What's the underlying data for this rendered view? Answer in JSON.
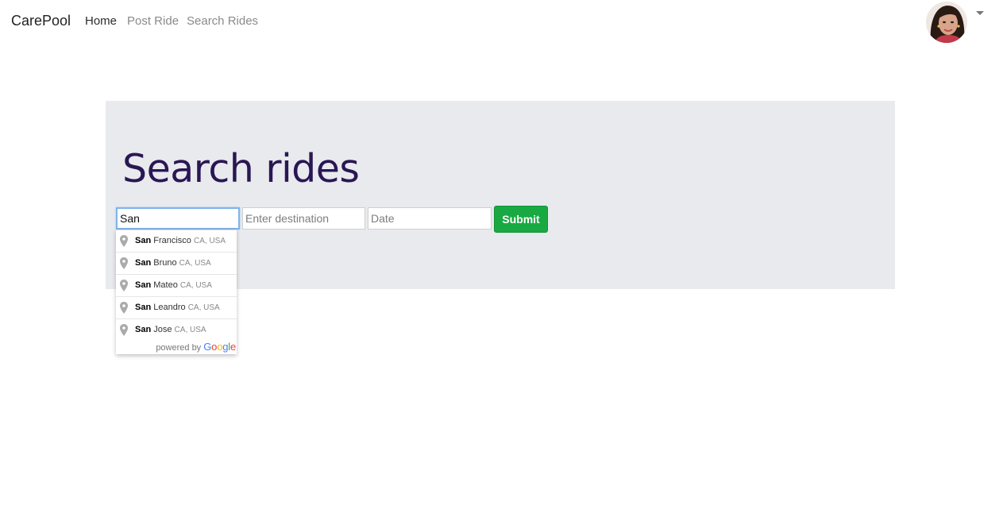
{
  "navbar": {
    "brand": "CarePool",
    "links": [
      {
        "label": "Home",
        "active": true
      },
      {
        "label": "Post Ride",
        "active": false
      },
      {
        "label": "Search Rides",
        "active": false
      }
    ],
    "profile_icon": "avatar-photo",
    "dropdown_icon": "caret-down-icon"
  },
  "jumbotron": {
    "title": "Search rides"
  },
  "form": {
    "origin_value": "San",
    "destination_placeholder": "Enter destination",
    "date_placeholder": "Date",
    "submit_label": "Submit"
  },
  "autocomplete": {
    "suggestions": [
      {
        "match": "San",
        "rest": " Francisco",
        "secondary": "CA, USA"
      },
      {
        "match": "San",
        "rest": " Bruno",
        "secondary": "CA, USA"
      },
      {
        "match": "San",
        "rest": " Mateo",
        "secondary": "CA, USA"
      },
      {
        "match": "San",
        "rest": " Leandro",
        "secondary": "CA, USA"
      },
      {
        "match": "San",
        "rest": " Jose",
        "secondary": "CA, USA"
      }
    ],
    "powered_by": "powered by",
    "google_letters": [
      "G",
      "o",
      "o",
      "g",
      "l",
      "e"
    ]
  },
  "colors": {
    "title": "#2a1654",
    "jumbotron_bg": "#e8eaee",
    "submit_bg": "#19a942",
    "focus_border": "#7fb4ea"
  }
}
